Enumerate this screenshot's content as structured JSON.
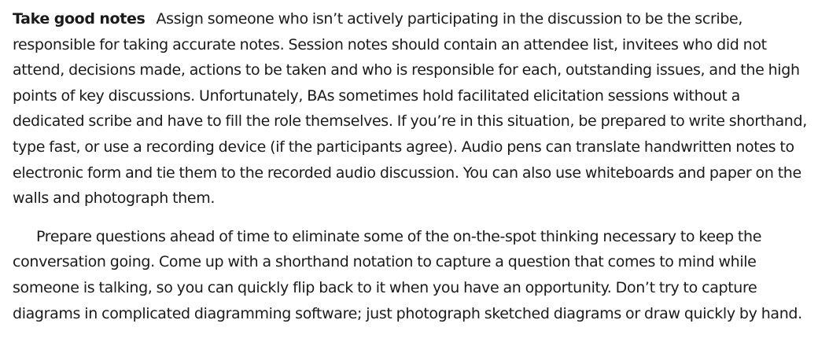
{
  "section": {
    "heading": "Take good notes",
    "paragraph_1": "Assign someone who isn’t actively participating in the discussion to be the scribe, responsible for taking accurate notes. Session notes should contain an attendee list, invitees who did not attend, decisions made, actions to be taken and who is responsible for each, outstanding issues, and the high points of key discussions. Unfortunately, BAs sometimes hold facilitated elicitation sessions without a dedicated scribe and have to fill the role themselves. If you’re in this situation, be prepared to write shorthand, type fast, or use a recording device (if the participants agree). Audio pens can translate handwritten notes to electronic form and tie them to the recorded audio discussion. You can also use whiteboards and paper on the walls and photograph them.",
    "paragraph_2": "Prepare questions ahead of time to eliminate some of the on-the-spot thinking necessary to keep the conversation going. Come up with a shorthand notation to capture a question that comes to mind while someone is talking, so you can quickly flip back to it when you have an opportunity. Don’t try to capture diagrams in complicated diagramming software; just photograph sketched diagrams or draw quickly by hand."
  }
}
